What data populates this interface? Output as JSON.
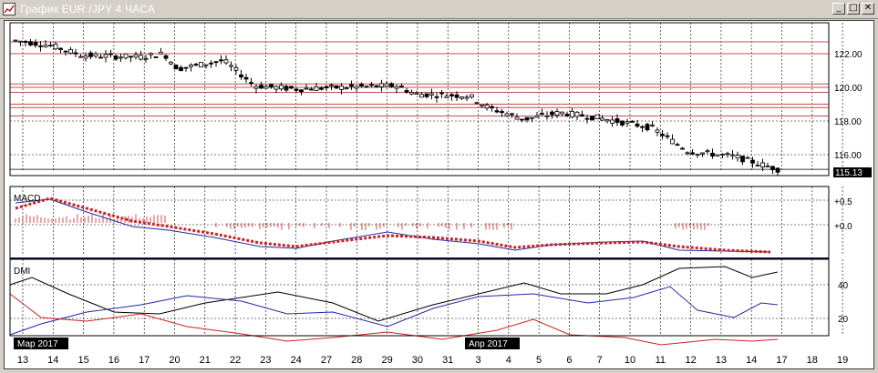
{
  "window": {
    "title": "График EUR /JPY  4 ЧАСА",
    "minimize_glyph": "_",
    "maximize_glyph": "□",
    "close_glyph": "✕"
  },
  "price_panel": {
    "y_ticks": [
      "122.00",
      "120.00",
      "118.00",
      "116.00"
    ],
    "current_price": "115.13",
    "level_lines": [
      122.7,
      122.0,
      120.2,
      120.0,
      119.7,
      119.0,
      118.8,
      118.3
    ],
    "colors": {
      "levels": "#c0504d",
      "candles": "#000000"
    }
  },
  "macd_panel": {
    "label": "MACD",
    "y_ticks": [
      "+0.5",
      "+0.0"
    ]
  },
  "dmi_panel": {
    "label": "DMI",
    "y_ticks": [
      "40",
      "20"
    ],
    "colors": {
      "adx": "#000000",
      "plus_di": "#1f2aa8",
      "minus_di": "#cc2222"
    }
  },
  "x_axis": {
    "days": [
      "13",
      "14",
      "15",
      "16",
      "17",
      "20",
      "21",
      "22",
      "23",
      "24",
      "27",
      "28",
      "29",
      "30",
      "31",
      "3",
      "4",
      "5",
      "6",
      "7",
      "10",
      "11",
      "12",
      "13",
      "14",
      "17",
      "18",
      "19"
    ],
    "month_markers": [
      "Мар 2017",
      "Апр 2017"
    ]
  }
}
